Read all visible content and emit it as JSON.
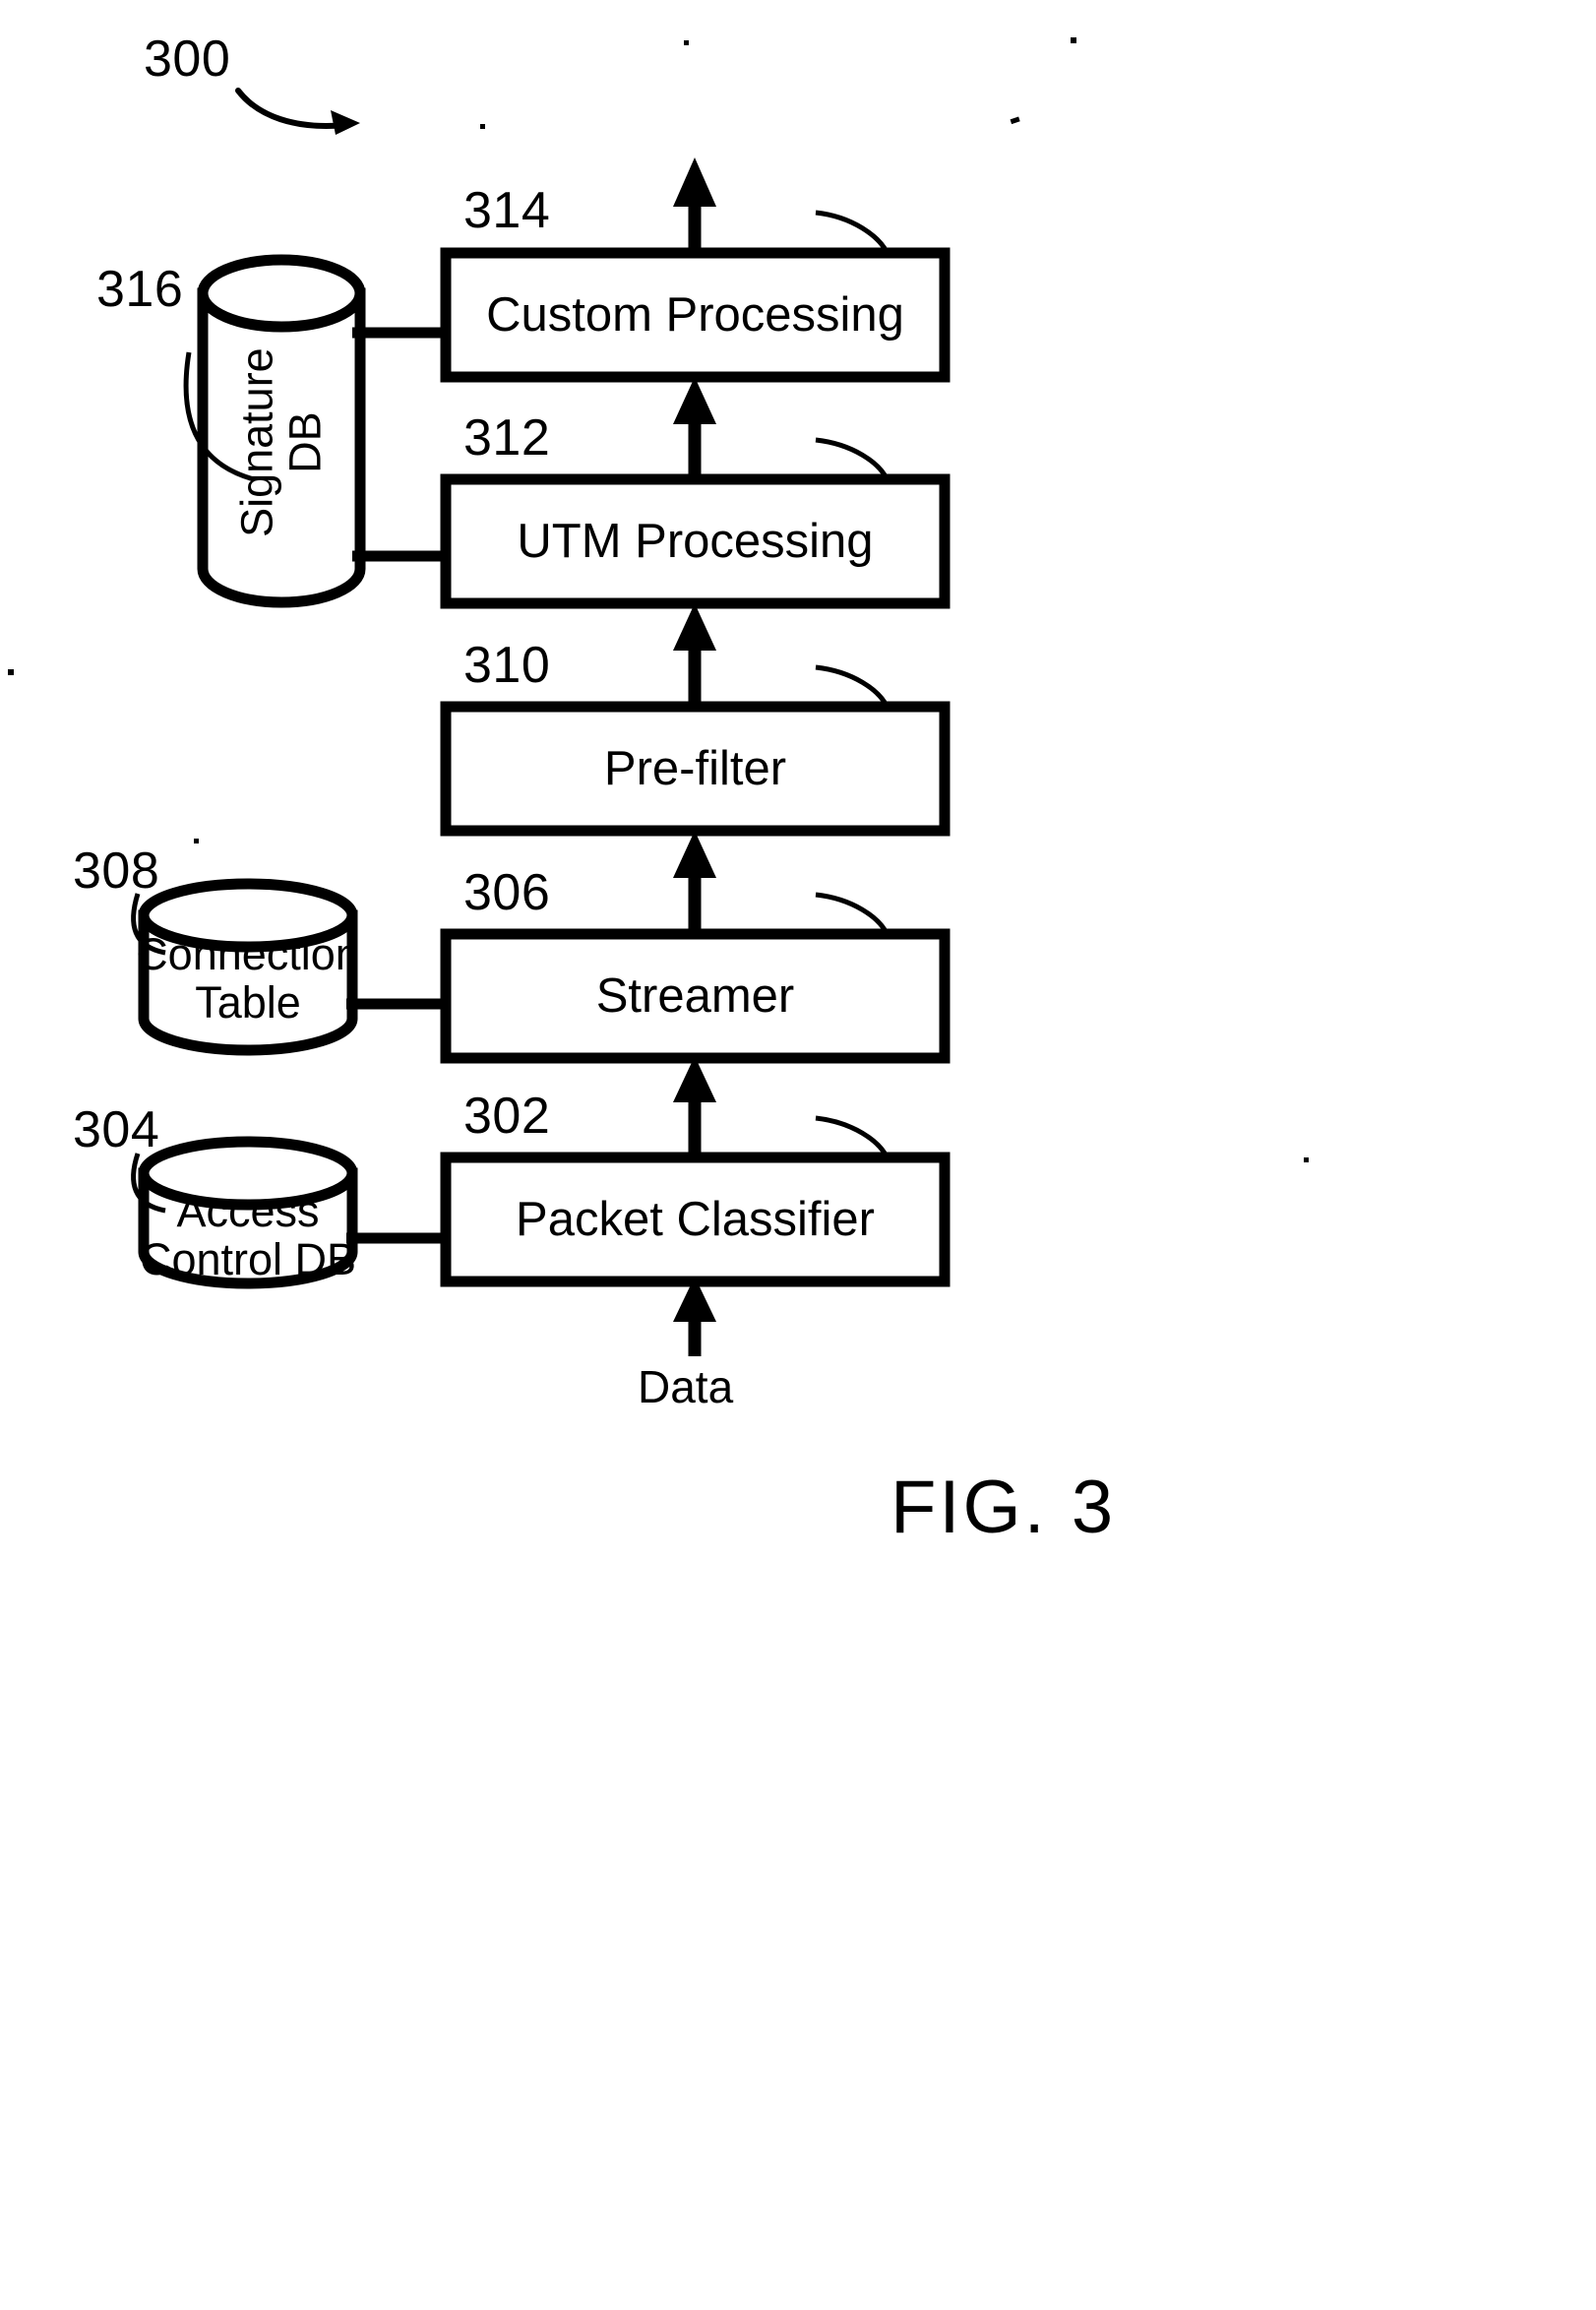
{
  "figure": {
    "number_label": "300",
    "caption": "FIG. 3"
  },
  "blocks": [
    {
      "id": "314",
      "label": "Custom Processing",
      "ref": "314"
    },
    {
      "id": "312",
      "label": "UTM Processing",
      "ref": "312"
    },
    {
      "id": "310",
      "label": "Pre-filter",
      "ref": "310"
    },
    {
      "id": "306",
      "label": "Streamer",
      "ref": "306"
    },
    {
      "id": "302",
      "label": "Packet Classifier",
      "ref": "302"
    }
  ],
  "datastores": [
    {
      "id": "316",
      "label": "Signature DB",
      "ref": "316",
      "orientation": "vertical"
    },
    {
      "id": "308",
      "label_line1": "Connection",
      "label_line2": "Table",
      "ref": "308",
      "orientation": "horizontal"
    },
    {
      "id": "304",
      "label_line1": "Access",
      "label_line2": "Control DB",
      "ref": "304",
      "orientation": "horizontal"
    }
  ],
  "flow": {
    "input_label": "Data",
    "output_label": ""
  },
  "refs": {
    "r300": "300",
    "r302": "302",
    "r304": "304",
    "r306": "306",
    "r308": "308",
    "r310": "310",
    "r312": "312",
    "r314": "314",
    "r316": "316"
  },
  "colors": {
    "ink": "#000000",
    "paper": "#ffffff"
  }
}
